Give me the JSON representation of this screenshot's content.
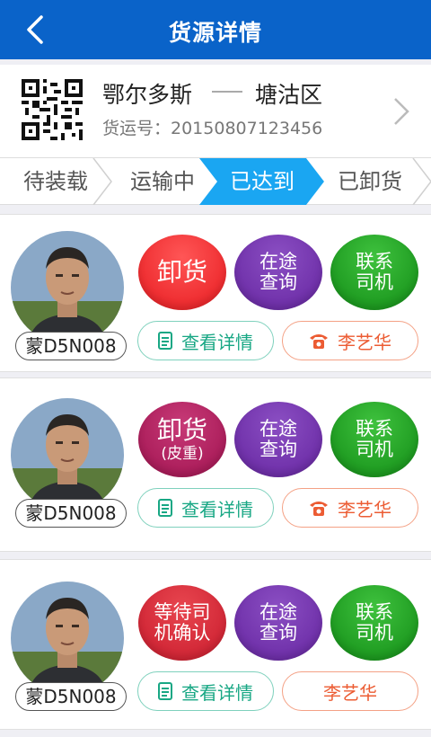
{
  "header": {
    "title": "货源详情",
    "back_icon": "chevron-left-icon"
  },
  "route": {
    "from": "鄂尔多斯",
    "to": "塘沽区",
    "waybill": "货运号：20150807123456",
    "qr_icon": "qr-code-icon",
    "arrow_icon": "chevron-right-icon"
  },
  "steps": [
    {
      "label": "待装载",
      "active": false
    },
    {
      "label": "运输中",
      "active": false
    },
    {
      "label": "已达到",
      "active": true
    },
    {
      "label": "已卸货",
      "active": false
    }
  ],
  "colors": {
    "header": "#0a63c9",
    "active_step": "#1aa6f2",
    "detail": "#18a784",
    "phone": "#ec5c33"
  },
  "cards": [
    {
      "plate": "蒙D5N008",
      "action": {
        "line1": "卸货",
        "line2": ""
      },
      "track": {
        "line1": "在途",
        "line2": "查询"
      },
      "contact": {
        "line1": "联系",
        "line2": "司机"
      },
      "detail": "查看详情",
      "driver": "李艺华",
      "has_phone_icon": true
    },
    {
      "plate": "蒙D5N008",
      "action": {
        "line1": "卸货",
        "line2": "(皮重)"
      },
      "track": {
        "line1": "在途",
        "line2": "查询"
      },
      "contact": {
        "line1": "联系",
        "line2": "司机"
      },
      "detail": "查看详情",
      "driver": "李艺华",
      "has_phone_icon": true
    },
    {
      "plate": "蒙D5N008",
      "action": {
        "line1": "等待司",
        "line2": "机确认"
      },
      "track": {
        "line1": "在途",
        "line2": "查询"
      },
      "contact": {
        "line1": "联系",
        "line2": "司机"
      },
      "detail": "查看详情",
      "driver": "李艺华",
      "has_phone_icon": false
    }
  ]
}
